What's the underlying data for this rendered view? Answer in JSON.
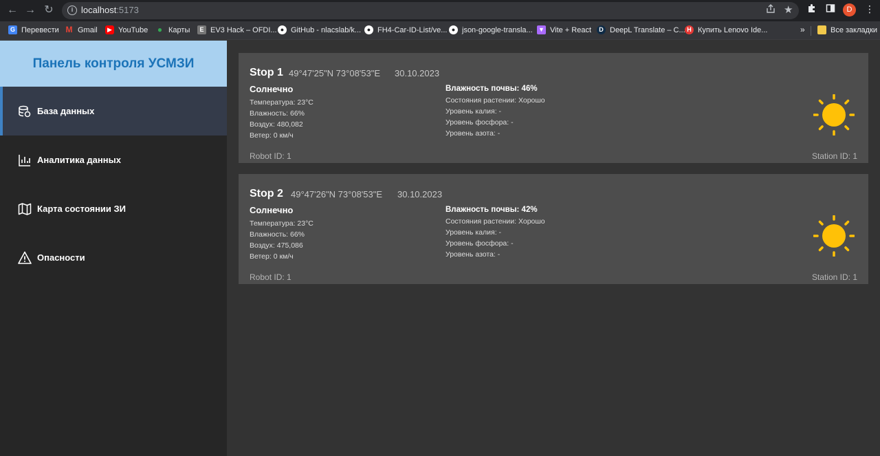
{
  "browser": {
    "url_host": "localhost",
    "url_port": ":5173",
    "profile_initial": "D",
    "bookmarks": [
      {
        "label": "Перевести",
        "icon": "google-translate-icon",
        "color": "#4285f4"
      },
      {
        "label": "Gmail",
        "icon": "gmail-icon",
        "color": "#ea4335"
      },
      {
        "label": "YouTube",
        "icon": "youtube-icon",
        "color": "#ff0000"
      },
      {
        "label": "Карты",
        "icon": "maps-icon",
        "color": "#34a853"
      },
      {
        "label": "EV3 Hack – OFDI...",
        "icon": "ev3-icon",
        "color": "#777777"
      },
      {
        "label": "GitHub - nlacslab/k...",
        "icon": "github-icon",
        "color": "#ffffff"
      },
      {
        "label": "FH4-Car-ID-List/ve...",
        "icon": "github-icon",
        "color": "#ffffff"
      },
      {
        "label": "json-google-transla...",
        "icon": "github-icon",
        "color": "#ffffff"
      },
      {
        "label": "Vite + React",
        "icon": "vite-icon",
        "color": "#a96bff"
      },
      {
        "label": "DeepL Translate – C...",
        "icon": "deepl-icon",
        "color": "#0f2b46"
      },
      {
        "label": "Купить Lenovo Ide...",
        "icon": "shop-icon",
        "color": "#e53935"
      }
    ],
    "more_label": "»",
    "all_bookmarks_label": "Все закладки"
  },
  "sidebar": {
    "title": "Панель контроля УСМЗИ",
    "items": [
      {
        "label": "База данных",
        "icon": "database-icon",
        "active": true
      },
      {
        "label": "Аналитика данных",
        "icon": "analytics-icon",
        "active": false
      },
      {
        "label": "Карта состоянии ЗИ",
        "icon": "map-icon",
        "active": false
      },
      {
        "label": "Опасности",
        "icon": "warning-icon",
        "active": false
      }
    ]
  },
  "colors": {
    "accent": "#1b73b8",
    "header_bg": "#a9d1f0",
    "sun": "#ffc107"
  },
  "stops": [
    {
      "title": "Stop 1",
      "coords": "49°47'25\"N 73°08'53\"E",
      "date": "30.10.2023",
      "weather": "Солнечно",
      "temperature": "Температура: 23°C",
      "humidity": "Влажность: 66%",
      "air": "Воздух: 480,082",
      "wind": "Ветер: 0 км/ч",
      "robot_id": "Robot ID: 1",
      "soil_humidity": "Влажность почвы: 46%",
      "plant_state": "Состояния растении: Хорошо",
      "potassium": "Уровень калия: -",
      "phosphorus": "Уровень фосфора: -",
      "nitrogen": "Уровень азота: -",
      "station_id": "Station ID: 1",
      "weather_icon": "sun-icon"
    },
    {
      "title": "Stop 2",
      "coords": "49°47'26\"N 73°08'53\"E",
      "date": "30.10.2023",
      "weather": "Солнечно",
      "temperature": "Температура: 23°C",
      "humidity": "Влажность: 66%",
      "air": "Воздух: 475,086",
      "wind": "Ветер: 0 км/ч",
      "robot_id": "Robot ID: 1",
      "soil_humidity": "Влажность почвы: 42%",
      "plant_state": "Состояния растении: Хорошо",
      "potassium": "Уровень калия: -",
      "phosphorus": "Уровень фосфора: -",
      "nitrogen": "Уровень азота: -",
      "station_id": "Station ID: 1",
      "weather_icon": "sun-icon"
    }
  ]
}
